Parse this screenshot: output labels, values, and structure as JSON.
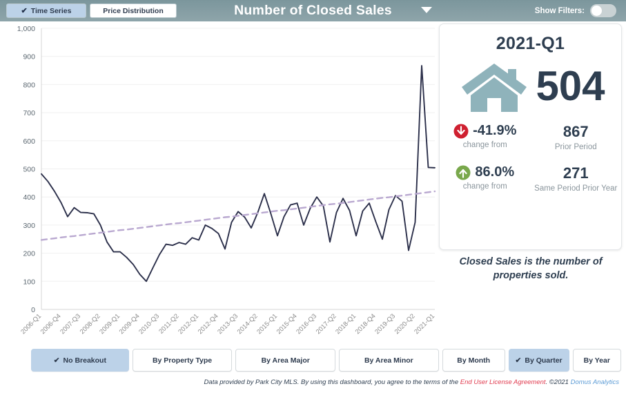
{
  "topbar": {
    "tabs": [
      {
        "label": "Time Series",
        "active": true,
        "check": "✔"
      },
      {
        "label": "Price Distribution",
        "active": false
      }
    ],
    "title": "Number of Closed Sales",
    "caret_icon": "chevron-down-icon",
    "filters_label": "Show Filters:",
    "filters_on": false
  },
  "card": {
    "period": "2021-Q1",
    "house_icon": "house-icon",
    "value": "504",
    "stats": [
      {
        "icon": "arrow-down-circle-icon",
        "direction": "down",
        "pct": "-41.9%",
        "sub": "change from",
        "compare_value": "867",
        "compare_label": "Prior Period"
      },
      {
        "icon": "arrow-up-circle-icon",
        "direction": "up",
        "pct": "86.0%",
        "sub": "change from",
        "compare_value": "271",
        "compare_label": "Same Period Prior Year"
      }
    ],
    "caption": "Closed Sales is the number of properties sold."
  },
  "breakouts": [
    {
      "label": "No Breakout",
      "active": true,
      "check": "✔"
    },
    {
      "label": "By Property Type",
      "active": false
    },
    {
      "label": "By Area Major",
      "active": false
    },
    {
      "label": "By Area Minor",
      "active": false
    },
    {
      "label": "By Month",
      "active": false
    },
    {
      "label": "By Quarter",
      "active": true,
      "check": "✔"
    },
    {
      "label": "By Year",
      "active": false
    }
  ],
  "footer": {
    "text_1": "Data provided by Park City MLS.  By using this dashboard, you agree to the terms of the ",
    "eula": "End User License Agreement",
    "text_2": ".  ©2021 ",
    "brand": "Domus Analytics"
  },
  "colors": {
    "header_bg": "#869ea4",
    "accent_blue": "#bcd2e8",
    "line": "#2b2f4a",
    "trend": "#b9a8d0",
    "house": "#8fb3bb",
    "down_red": "#cf2030",
    "up_green": "#79a84c",
    "text_dark": "#2e3e50"
  },
  "chart_data": {
    "type": "line",
    "title": "Number of Closed Sales",
    "xlabel": "",
    "ylabel": "",
    "ylim": [
      0,
      1000
    ],
    "ytick_step": 100,
    "yticks": [
      "0",
      "100",
      "200",
      "300",
      "400",
      "500",
      "600",
      "700",
      "800",
      "900",
      "1,000"
    ],
    "grid": true,
    "legend": "none",
    "xtick_every": 3,
    "xticks": [
      "2006-Q1",
      "2006-Q4",
      "2007-Q3",
      "2008-Q2",
      "2009-Q1",
      "2009-Q4",
      "2010-Q3",
      "2011-Q2",
      "2012-Q1",
      "2012-Q4",
      "2013-Q3",
      "2014-Q2",
      "2015-Q1",
      "2015-Q4",
      "2016-Q3",
      "2017-Q2",
      "2018-Q1",
      "2018-Q4",
      "2019-Q3",
      "2020-Q2",
      "2021-Q1"
    ],
    "categories": [
      "2006-Q1",
      "2006-Q2",
      "2006-Q3",
      "2006-Q4",
      "2007-Q1",
      "2007-Q2",
      "2007-Q3",
      "2007-Q4",
      "2008-Q1",
      "2008-Q2",
      "2008-Q3",
      "2008-Q4",
      "2009-Q1",
      "2009-Q2",
      "2009-Q3",
      "2009-Q4",
      "2010-Q1",
      "2010-Q2",
      "2010-Q3",
      "2010-Q4",
      "2011-Q1",
      "2011-Q2",
      "2011-Q3",
      "2011-Q4",
      "2012-Q1",
      "2012-Q2",
      "2012-Q3",
      "2012-Q4",
      "2013-Q1",
      "2013-Q2",
      "2013-Q3",
      "2013-Q4",
      "2014-Q1",
      "2014-Q2",
      "2014-Q3",
      "2014-Q4",
      "2015-Q1",
      "2015-Q2",
      "2015-Q3",
      "2015-Q4",
      "2016-Q1",
      "2016-Q2",
      "2016-Q3",
      "2016-Q4",
      "2017-Q1",
      "2017-Q2",
      "2017-Q3",
      "2017-Q4",
      "2018-Q1",
      "2018-Q2",
      "2018-Q3",
      "2018-Q4",
      "2019-Q1",
      "2019-Q2",
      "2019-Q3",
      "2019-Q4",
      "2020-Q1",
      "2020-Q2",
      "2020-Q3",
      "2020-Q4",
      "2021-Q1"
    ],
    "series": [
      {
        "name": "Closed Sales",
        "style": "solid",
        "color": "#2b2f4a",
        "values": [
          482,
          455,
          420,
          380,
          330,
          362,
          345,
          344,
          340,
          300,
          240,
          205,
          205,
          185,
          160,
          125,
          100,
          148,
          195,
          232,
          228,
          238,
          232,
          255,
          247,
          300,
          288,
          270,
          215,
          310,
          348,
          328,
          290,
          345,
          412,
          340,
          262,
          330,
          372,
          378,
          300,
          360,
          400,
          368,
          240,
          345,
          395,
          352,
          262,
          350,
          378,
          312,
          250,
          355,
          405,
          385,
          210,
          310,
          867,
          505,
          504
        ]
      },
      {
        "name": "Trend",
        "style": "dashed",
        "color": "#b9a8d0",
        "values": [
          247,
          250,
          253,
          256,
          259,
          261,
          264,
          267,
          270,
          273,
          276,
          279,
          282,
          284,
          287,
          290,
          293,
          296,
          299,
          302,
          305,
          307,
          310,
          313,
          316,
          319,
          322,
          325,
          328,
          330,
          333,
          336,
          339,
          342,
          345,
          348,
          351,
          353,
          356,
          359,
          362,
          365,
          368,
          371,
          374,
          376,
          379,
          382,
          385,
          388,
          391,
          394,
          397,
          399,
          402,
          405,
          408,
          411,
          414,
          417,
          420
        ]
      }
    ]
  }
}
